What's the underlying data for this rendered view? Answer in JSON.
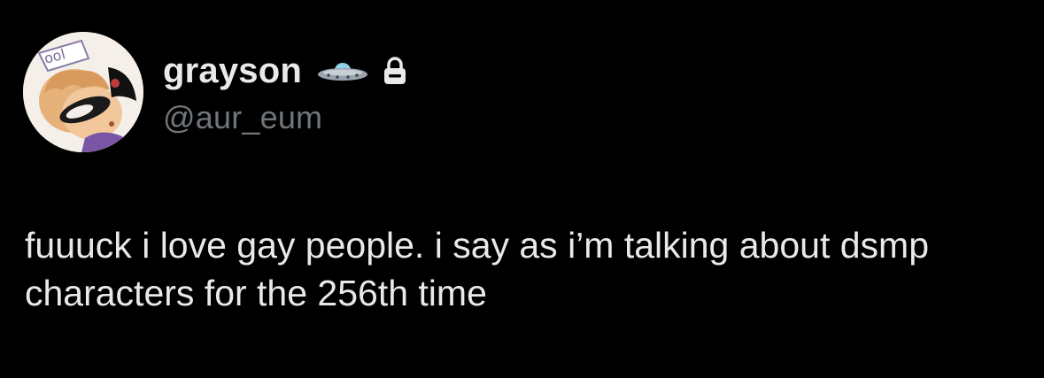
{
  "user": {
    "display_name": "grayson",
    "handle": "@aur_eum",
    "emoji_icon": "ufo-icon",
    "protected_icon": "lock-icon",
    "avatar_text": "ool"
  },
  "tweet": {
    "text": "fuuuck i love gay people. i say as i’m talking about dsmp characters for the 256th time"
  },
  "colors": {
    "background": "#000000",
    "primary_text": "#e7e9ea",
    "secondary_text": "#71767b"
  }
}
